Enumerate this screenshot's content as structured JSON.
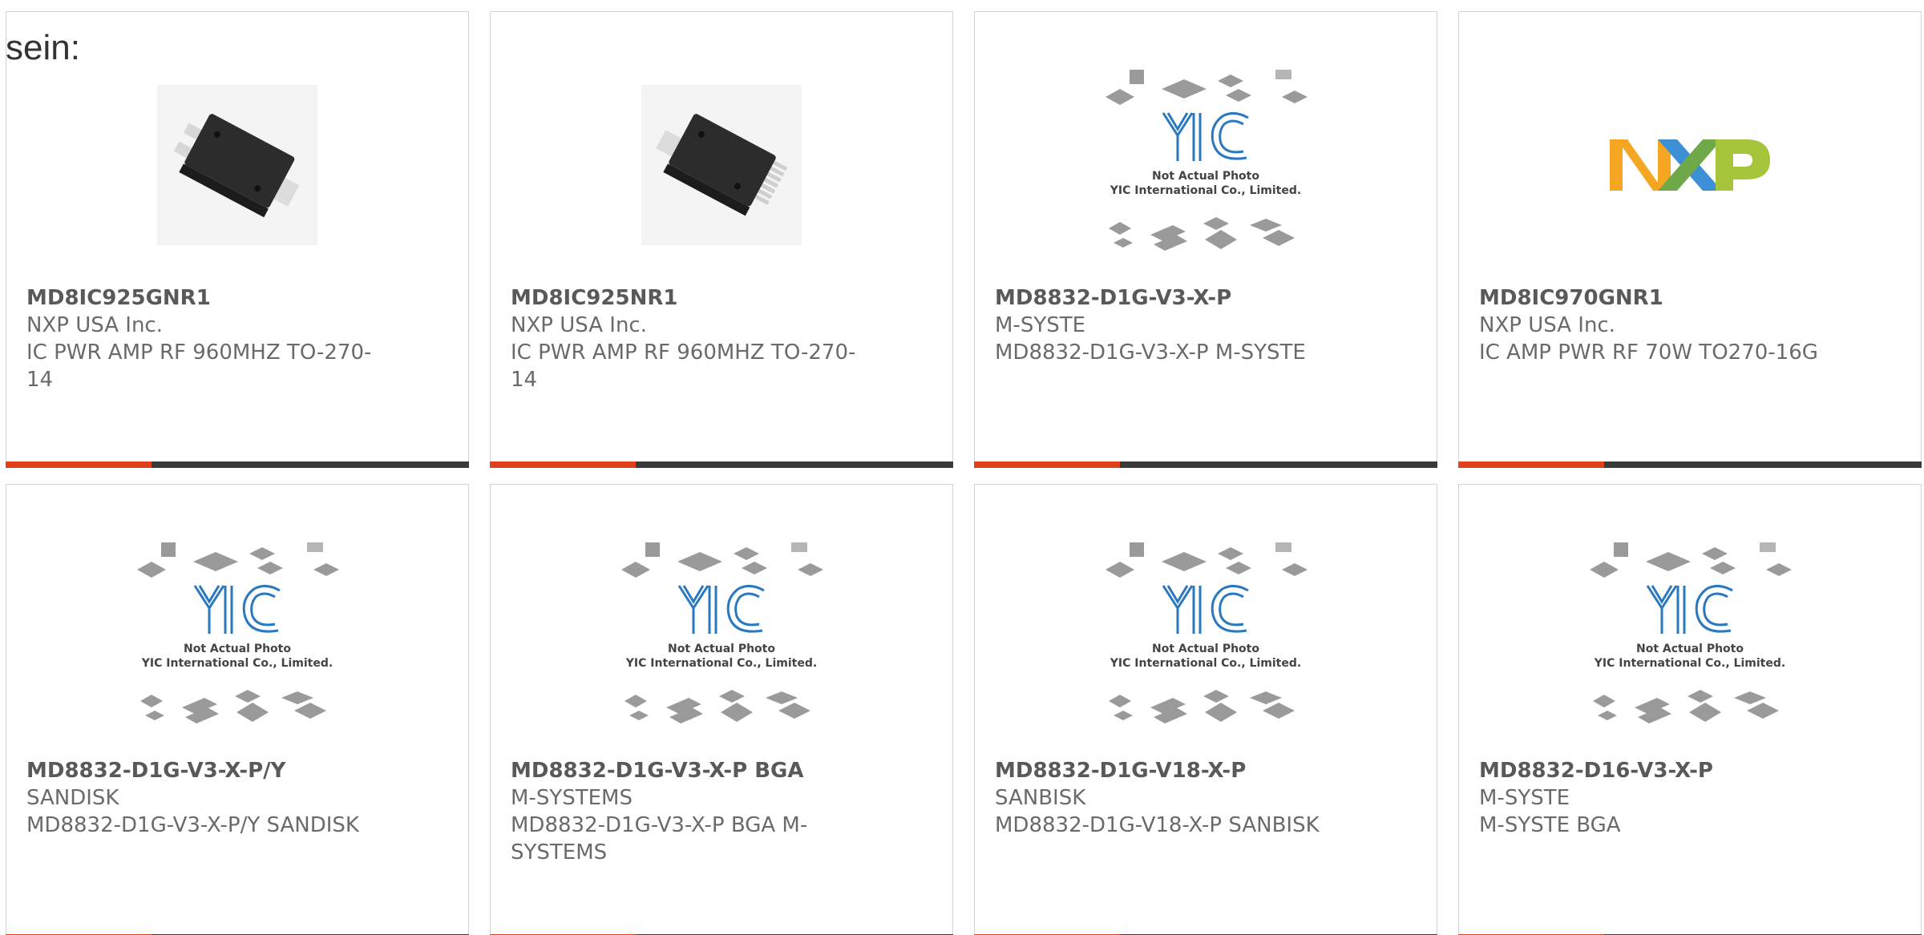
{
  "caption": "sein:",
  "colors": {
    "accent": "#e0401c",
    "bar": "#3a3a3a",
    "yic_blue": "#2a78c0",
    "nxp_orange": "#f5a623",
    "nxp_blue": "#3d8fd6",
    "nxp_green": "#a6c53b"
  },
  "placeholder": {
    "line1": "Not Actual Photo",
    "line2": "YIC International Co., Limited."
  },
  "products": [
    {
      "part": "MD8IC925GNR1",
      "manufacturer": "NXP USA Inc.",
      "description": "IC PWR AMP RF 960MHZ TO-270-14",
      "image": "chip-package-photo"
    },
    {
      "part": "MD8IC925NR1",
      "manufacturer": "NXP USA Inc.",
      "description": "IC PWR AMP RF 960MHZ TO-270-14",
      "image": "chip-package-photo"
    },
    {
      "part": "MD8832-D1G-V3-X-P",
      "manufacturer": "M-SYSTE",
      "description": "MD8832-D1G-V3-X-P M-SYSTE",
      "image": "yic-placeholder"
    },
    {
      "part": "MD8IC970GNR1",
      "manufacturer": "NXP USA Inc.",
      "description": "IC AMP PWR RF 70W TO270-16G",
      "image": "nxp-logo"
    },
    {
      "part": "MD8832-D1G-V3-X-P/Y",
      "manufacturer": "SANDISK",
      "description": "MD8832-D1G-V3-X-P/Y SANDISK",
      "image": "yic-placeholder"
    },
    {
      "part": "MD8832-D1G-V3-X-P BGA",
      "manufacturer": "M-SYSTEMS",
      "description": "MD8832-D1G-V3-X-P BGA M-SYSTEMS",
      "image": "yic-placeholder"
    },
    {
      "part": "MD8832-D1G-V18-X-P",
      "manufacturer": "SANBISK",
      "description": "MD8832-D1G-V18-X-P SANBISK",
      "image": "yic-placeholder"
    },
    {
      "part": "MD8832-D16-V3-X-P",
      "manufacturer": "M-SYSTE",
      "description": "M-SYSTE BGA",
      "image": "yic-placeholder"
    }
  ]
}
